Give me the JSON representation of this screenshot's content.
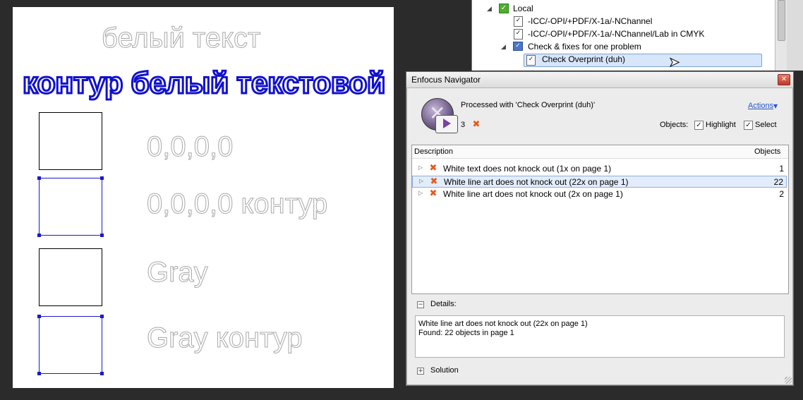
{
  "page": {
    "title_white_text": "белый текст",
    "outlined_text": "контур белый текстовой",
    "labels": [
      "0,0,0,0",
      "0,0,0,0 контур",
      "Gray",
      "Gray контур"
    ]
  },
  "tree": {
    "items": [
      {
        "label": "Local"
      },
      {
        "label": "-ICC/-OPI/+PDF/X-1a/-NChannel"
      },
      {
        "label": "-ICC/-OPI/+PDF/X-1a/-NChannel/Lab in CMYK"
      },
      {
        "label": "Check & fixes for one problem"
      },
      {
        "label": "Check Overprint (duh)"
      }
    ]
  },
  "navigator": {
    "title": "Enfocus Navigator",
    "processed_with": "Processed with 'Check Overprint (duh)'",
    "problem_count": "3",
    "actions_label": "Actions",
    "objects_label": "Objects:",
    "highlight_label": "Highlight",
    "select_label": "Select",
    "columns": {
      "description": "Description",
      "objects": "Objects"
    },
    "rows": [
      {
        "description": "White text does not knock out (1x on page 1)",
        "objects": "1"
      },
      {
        "description": "White line art does not knock out (22x on page 1)",
        "objects": "22"
      },
      {
        "description": "White line art does not knock out (2x on page 1)",
        "objects": "2"
      }
    ],
    "details_label": "Details:",
    "details_line1": "White line art does not knock out (22x on page 1)",
    "details_line2": "Found: 22 objects in page 1",
    "solution_label": "Solution"
  },
  "colors": {
    "outline_blue": "#1010d0",
    "error_orange": "#e25a1c",
    "selection_blue": "#d8e6fb"
  }
}
